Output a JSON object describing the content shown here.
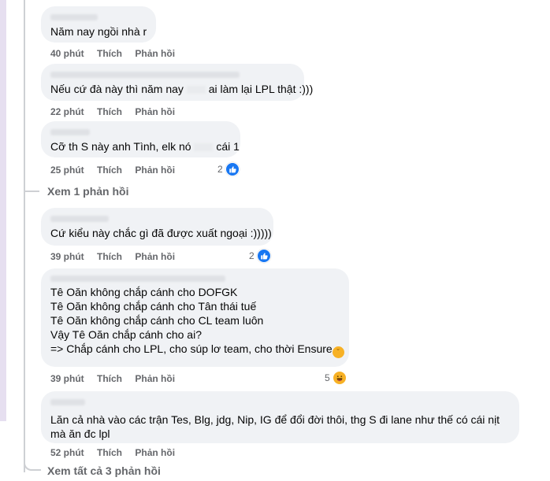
{
  "actions": {
    "like": "Thích",
    "reply": "Phản hồi"
  },
  "comments": [
    {
      "lines": [
        "Năm nay ngồi nhà r"
      ],
      "time": "40 phút"
    },
    {
      "lines": [
        "Nếu cứ đà này thì năm nay",
        "ai làm lại LPL thật :)))"
      ],
      "time": "22 phút"
    },
    {
      "lines": [
        "Cỡ th S này anh Tình, elk nó",
        "cái 1"
      ],
      "time": "25 phút",
      "reaction_count": "2"
    },
    {
      "lines": [
        "Cứ kiểu này chắc gì đã được xuất ngoại :)))))"
      ],
      "time": "39 phút",
      "reaction_count": "2"
    },
    {
      "lines": [
        "Tê Oăn không chắp cánh cho DOFGK",
        "Tê Oăn không chắp cánh cho Tân thái tuế",
        "Tê Oăn không chắp cánh cho CL team luôn",
        "Vậy Tê Oăn chắp cánh cho ai?",
        "=> Chắp cánh cho LPL, cho súp lơ team, cho thời Ensure"
      ],
      "time": "39 phút",
      "reaction_count": "5"
    },
    {
      "lines": [
        "Lăn cả nhà vào các trận Tes, Blg, jdg, Nip, IG để đổi đời thôi, thg S đi lane như thế có cái nịt",
        "mà ăn đc lpl"
      ],
      "time": "52 phút"
    }
  ],
  "view_one_reply": "Xem 1 phản hồi",
  "view_all_replies": "Xem tất cả 3 phản hồi",
  "colors": {
    "bubble": "#f0f2f5",
    "meta": "#65676b",
    "like_blue": "#1877f2",
    "haha_yellow": "#f7b125"
  },
  "icons": {
    "like": "like-reaction-icon",
    "haha": "haha-reaction-icon",
    "tired": "tired-face-emoji"
  }
}
